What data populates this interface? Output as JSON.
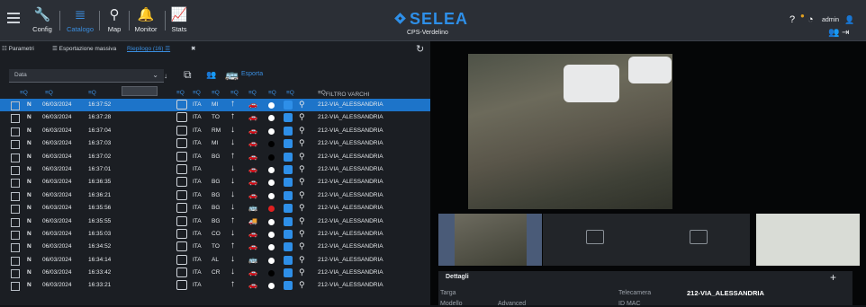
{
  "header": {
    "nav": [
      {
        "label": "Config",
        "icon": "wrench-icon"
      },
      {
        "label": "Catalogo",
        "icon": "list-icon",
        "active": true
      },
      {
        "label": "Map",
        "icon": "map-pin-icon"
      },
      {
        "label": "Monitor",
        "icon": "bell-icon"
      },
      {
        "label": "Stats",
        "icon": "chart-icon"
      }
    ],
    "brand": "SELEA",
    "subtitle": "CPS-Verdelino",
    "user": "admin"
  },
  "toolbar": {
    "tabs": [
      "Parametri",
      "Esportazione massiva",
      "Riepilogo (16)"
    ],
    "filter_label": "Data",
    "export_label": "Esporta"
  },
  "columns": {
    "camera_filter": "FILTRO VARCHI"
  },
  "rows": [
    {
      "n": "N",
      "date": "06/03/2024",
      "time": "16:37:52",
      "nat": "ITA",
      "prov": "MI",
      "dir": "↑",
      "veh": "car",
      "dot": "#ffffff",
      "pin": "●",
      "cam": "212-VIA_ALESSANDRIA",
      "sel": true
    },
    {
      "n": "N",
      "date": "06/03/2024",
      "time": "16:37:28",
      "nat": "ITA",
      "prov": "TO",
      "dir": "↑",
      "veh": "car",
      "dot": "#ffffff",
      "cam": "212-VIA_ALESSANDRIA"
    },
    {
      "n": "N",
      "date": "06/03/2024",
      "time": "16:37:04",
      "nat": "ITA",
      "prov": "RM",
      "dir": "↓",
      "veh": "car",
      "dot": "#ffffff",
      "cam": "212-VIA_ALESSANDRIA"
    },
    {
      "n": "N",
      "date": "06/03/2024",
      "time": "16:37:03",
      "nat": "ITA",
      "prov": "MI",
      "dir": "↓",
      "veh": "car",
      "dot": "#000000",
      "cam": "212-VIA_ALESSANDRIA"
    },
    {
      "n": "N",
      "date": "06/03/2024",
      "time": "16:37:02",
      "nat": "ITA",
      "prov": "BG",
      "dir": "↑",
      "veh": "car",
      "dot": "#000000",
      "cam": "212-VIA_ALESSANDRIA"
    },
    {
      "n": "N",
      "date": "06/03/2024",
      "time": "16:37:01",
      "nat": "ITA",
      "prov": "",
      "dir": "↓",
      "veh": "car",
      "dot": "#ffffff",
      "cam": "212-VIA_ALESSANDRIA"
    },
    {
      "n": "N",
      "date": "06/03/2024",
      "time": "16:36:35",
      "nat": "ITA",
      "prov": "BG",
      "dir": "↓",
      "veh": "car",
      "dot": "#ffffff",
      "cam": "212-VIA_ALESSANDRIA"
    },
    {
      "n": "N",
      "date": "06/03/2024",
      "time": "16:36:21",
      "nat": "ITA",
      "prov": "BG",
      "dir": "↓",
      "veh": "car",
      "dot": "#ffffff",
      "cam": "212-VIA_ALESSANDRIA"
    },
    {
      "n": "N",
      "date": "06/03/2024",
      "time": "16:35:56",
      "nat": "ITA",
      "prov": "BG",
      "dir": "↓",
      "veh": "bus",
      "dot": "#e02020",
      "cam": "212-VIA_ALESSANDRIA"
    },
    {
      "n": "N",
      "date": "06/03/2024",
      "time": "16:35:55",
      "nat": "ITA",
      "prov": "BG",
      "dir": "↑",
      "veh": "truck",
      "dot": "#ffffff",
      "cam": "212-VIA_ALESSANDRIA"
    },
    {
      "n": "N",
      "date": "06/03/2024",
      "time": "16:35:03",
      "nat": "ITA",
      "prov": "CO",
      "dir": "↓",
      "veh": "car",
      "dot": "#ffffff",
      "cam": "212-VIA_ALESSANDRIA"
    },
    {
      "n": "N",
      "date": "06/03/2024",
      "time": "16:34:52",
      "nat": "ITA",
      "prov": "TO",
      "dir": "↑",
      "veh": "car",
      "dot": "#ffffff",
      "cam": "212-VIA_ALESSANDRIA"
    },
    {
      "n": "N",
      "date": "06/03/2024",
      "time": "16:34:14",
      "nat": "ITA",
      "prov": "AL",
      "dir": "↓",
      "veh": "bus",
      "dot": "#ffffff",
      "cam": "212-VIA_ALESSANDRIA"
    },
    {
      "n": "N",
      "date": "06/03/2024",
      "time": "16:33:42",
      "nat": "ITA",
      "prov": "CR",
      "dir": "↓",
      "veh": "car",
      "dot": "#000000",
      "cam": "212-VIA_ALESSANDRIA"
    },
    {
      "n": "N",
      "date": "06/03/2024",
      "time": "16:33:21",
      "nat": "ITA",
      "prov": "",
      "dir": "↑",
      "veh": "car",
      "dot": "#ffffff",
      "cam": "212-VIA_ALESSANDRIA"
    }
  ],
  "details": {
    "title": "Dettagli",
    "plate_label": "Targa",
    "model_label": "Modello",
    "model_value": "Advanced",
    "camera_label": "Telecamera",
    "camera_value": "212-VIA_ALESSANDRIA",
    "mac_label": "ID MAC"
  }
}
